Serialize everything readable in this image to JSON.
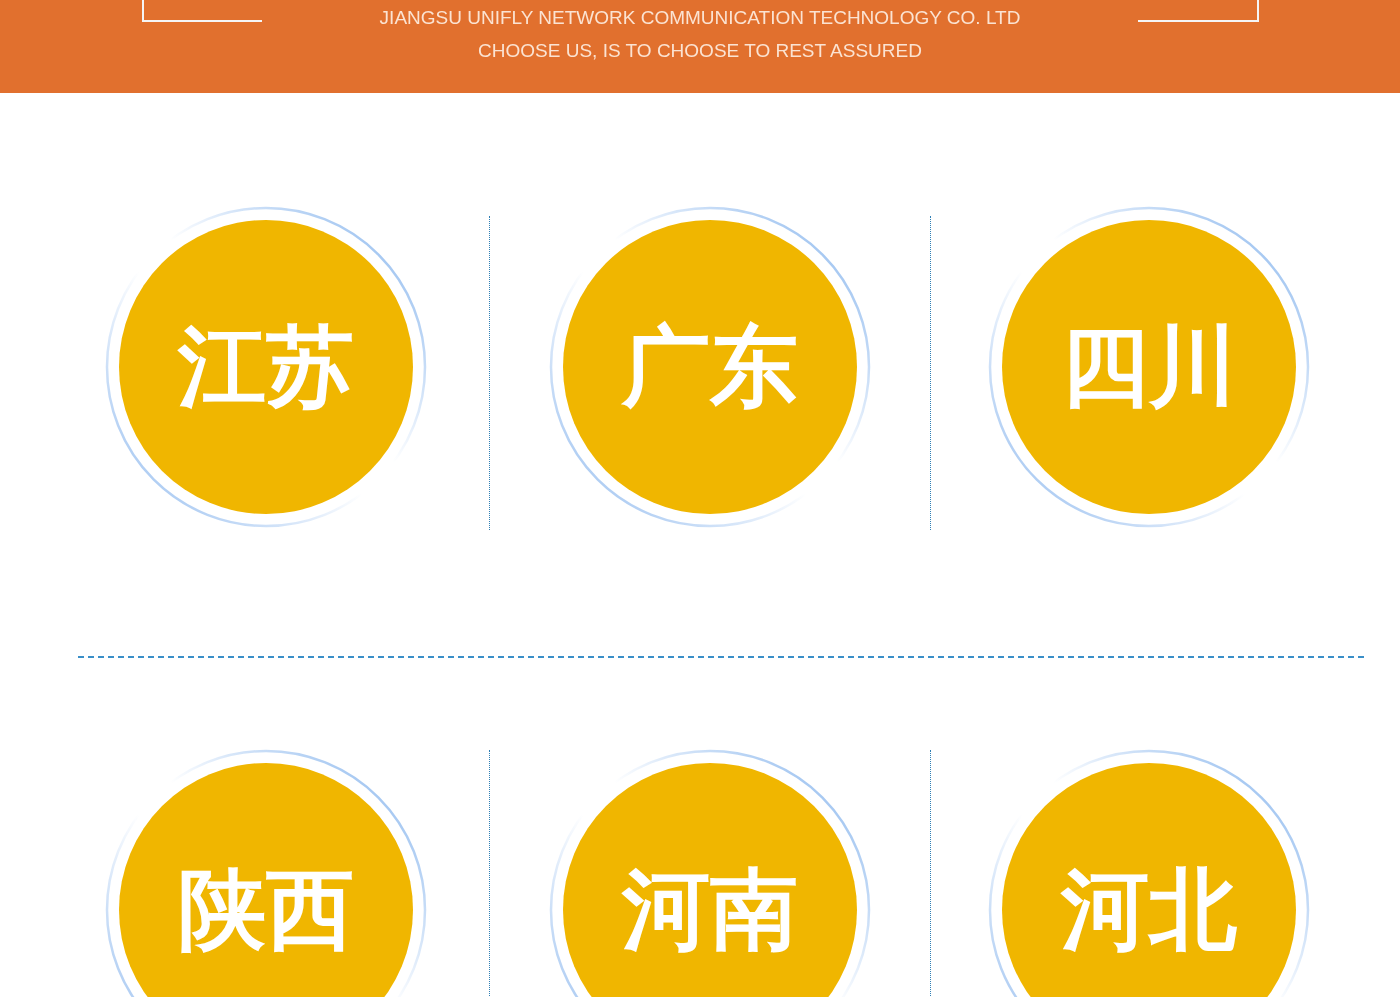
{
  "header": {
    "lines": [
      "JIANGSU UNIFLY NETWORK COMMUNICATION TECHNOLOGY CO. LTD",
      "CHOOSE US, IS TO CHOOSE TO REST ASSURED"
    ]
  },
  "region_rows": [
    [
      "江苏",
      "广东",
      "四川"
    ],
    [
      "陕西",
      "河南",
      "河北"
    ]
  ]
}
